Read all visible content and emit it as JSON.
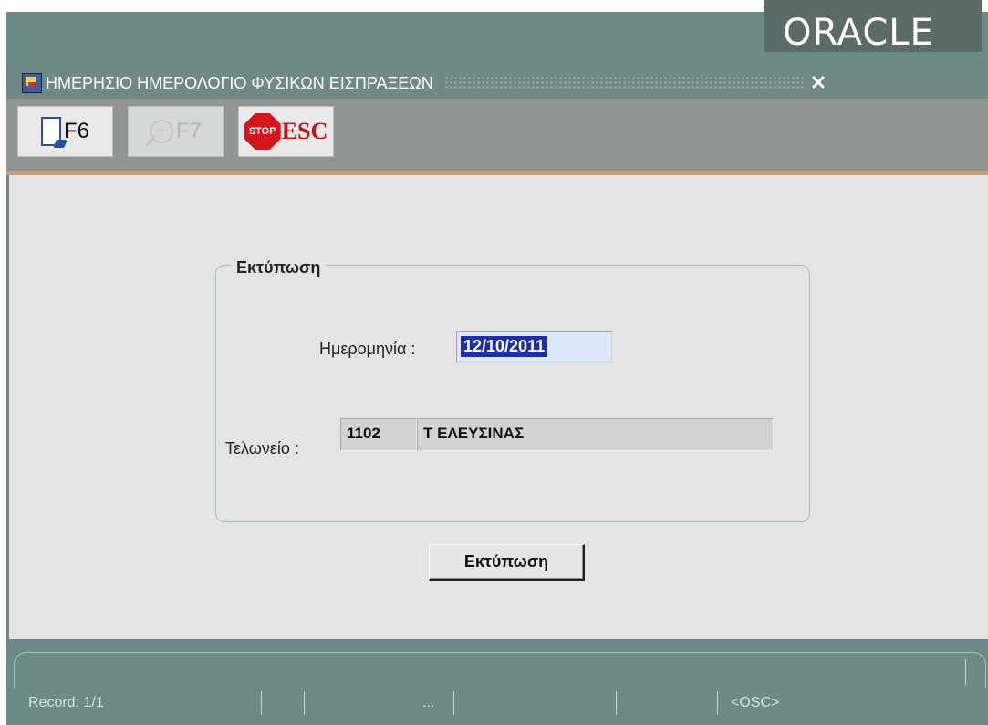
{
  "branding": {
    "logo_text": "ORACLE"
  },
  "window": {
    "title": "ΗΜΕΡΗΣΙΟ ΗΜΕΡΟΛΟΓΙΟ ΦΥΣΙΚΩΝ ΕΙΣΠΡΑΞΕΩΝ",
    "close_glyph": "✕"
  },
  "toolbar": {
    "buttons": [
      {
        "label": "F6",
        "icon": "new-document-icon",
        "enabled": true
      },
      {
        "label": "F7",
        "icon": "zoom-in-icon",
        "enabled": false
      },
      {
        "label": "ESC",
        "icon": "stop-sign-icon",
        "icon_text": "STOP",
        "enabled": true
      }
    ]
  },
  "form": {
    "group_title": "Εκτύπωση",
    "date_label": "Ημερομηνία :",
    "date_value": "12/10/2011",
    "office_label": "Τελωνείο :",
    "office_code": "1102",
    "office_name": "Τ ΕΛΕΥΣΙΝΑΣ",
    "print_button": "Εκτύπωση"
  },
  "status": {
    "record": "Record: 1/1",
    "ellipsis": "...",
    "mode": "<OSC>"
  },
  "colors": {
    "frame": "#6c8a86",
    "content": "#e4e4e4",
    "selection": "#1c2fa8",
    "toolbar_border": "#c3a07e"
  }
}
